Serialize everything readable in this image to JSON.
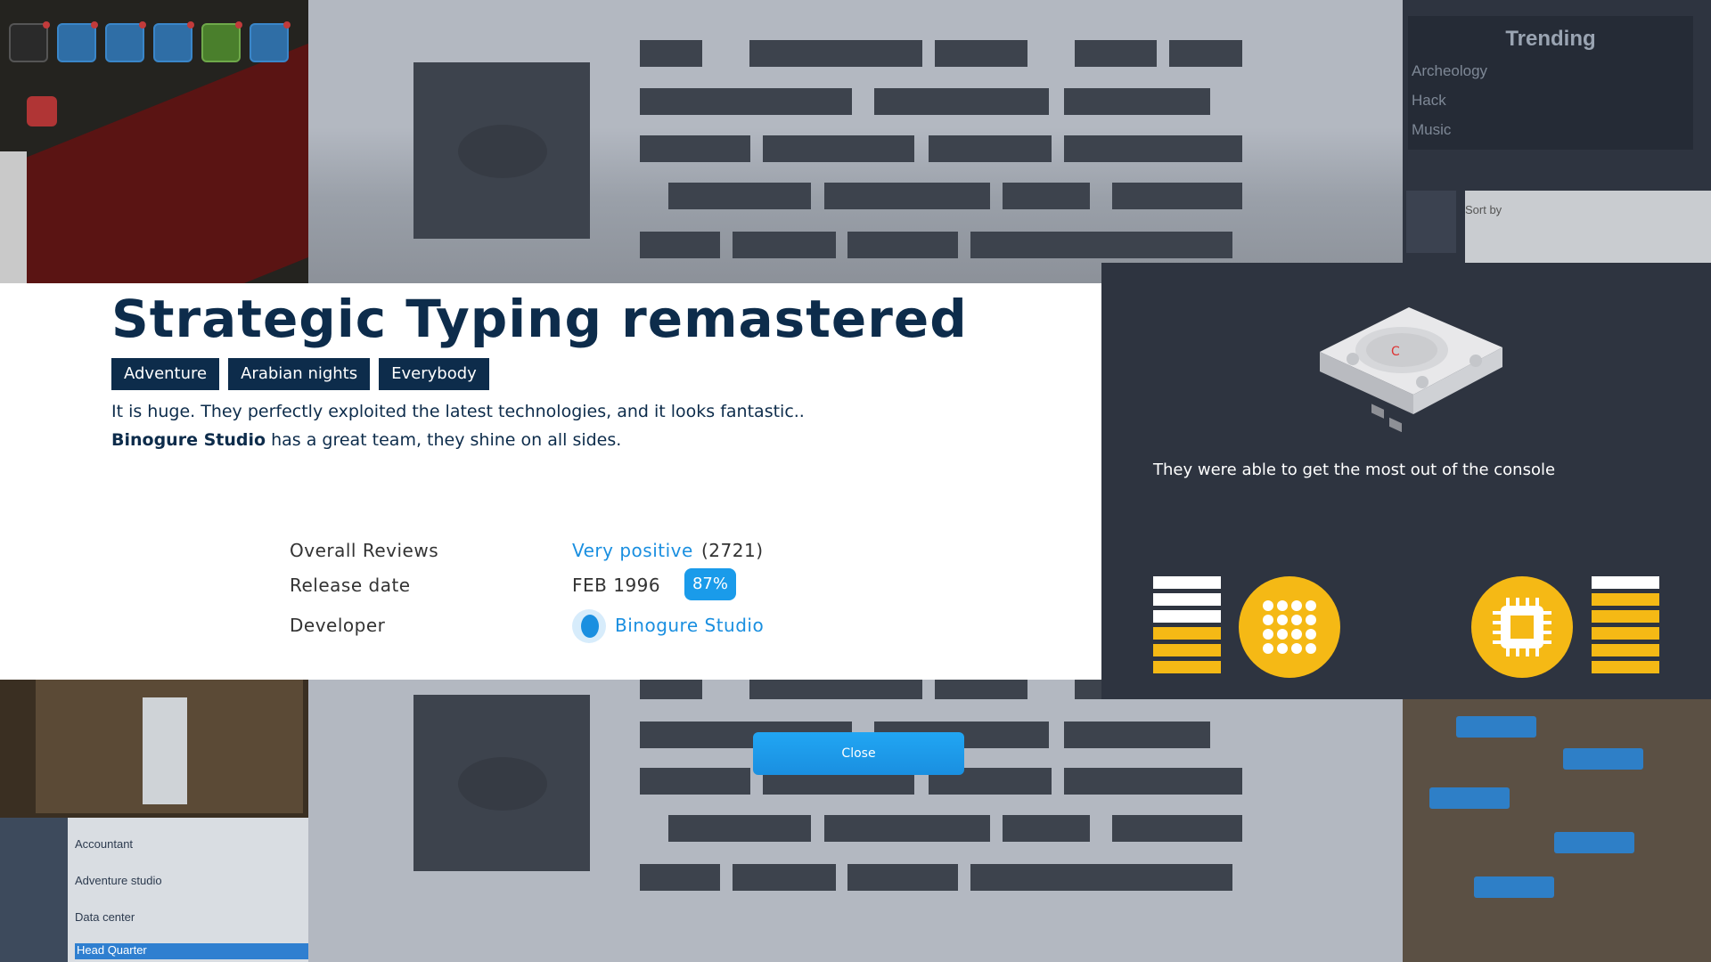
{
  "game": {
    "title": "Strategic Typing remastered",
    "tags": [
      "Adventure",
      "Arabian nights",
      "Everybody"
    ],
    "review_line1": "It is huge. They perfectly exploited the latest technologies, and it looks fantastic..",
    "review_studio": "Binogure Studio",
    "review_line2_rest": " has a great team, they shine on all sides."
  },
  "info": {
    "reviews_label": "Overall Reviews",
    "reviews_value": "Very positive",
    "reviews_count": "(2721)",
    "release_label": "Release date",
    "release_value": "FEB 1996",
    "score": "87%",
    "developer_label": "Developer",
    "developer_value": "Binogure Studio"
  },
  "console": {
    "caption": "They were able to get the most out of the console",
    "icon": "game-console",
    "left_stat_icon": "grid-icon",
    "right_stat_icon": "chip-icon",
    "left_level": 0.5,
    "right_level": 0.83
  },
  "close_label": "Close",
  "background": {
    "trending_title": "Trending",
    "trending_items": [
      "Archeology",
      "Hack",
      "Music"
    ],
    "sort_label": "Sort by",
    "build_items": [
      "Accountant",
      "Adventure studio",
      "Data center",
      "Head Quarter"
    ]
  },
  "colors": {
    "title": "#0d2c4b",
    "accent": "#1a8fe0",
    "stat": "#f5b915",
    "panel": "#2e3440"
  }
}
